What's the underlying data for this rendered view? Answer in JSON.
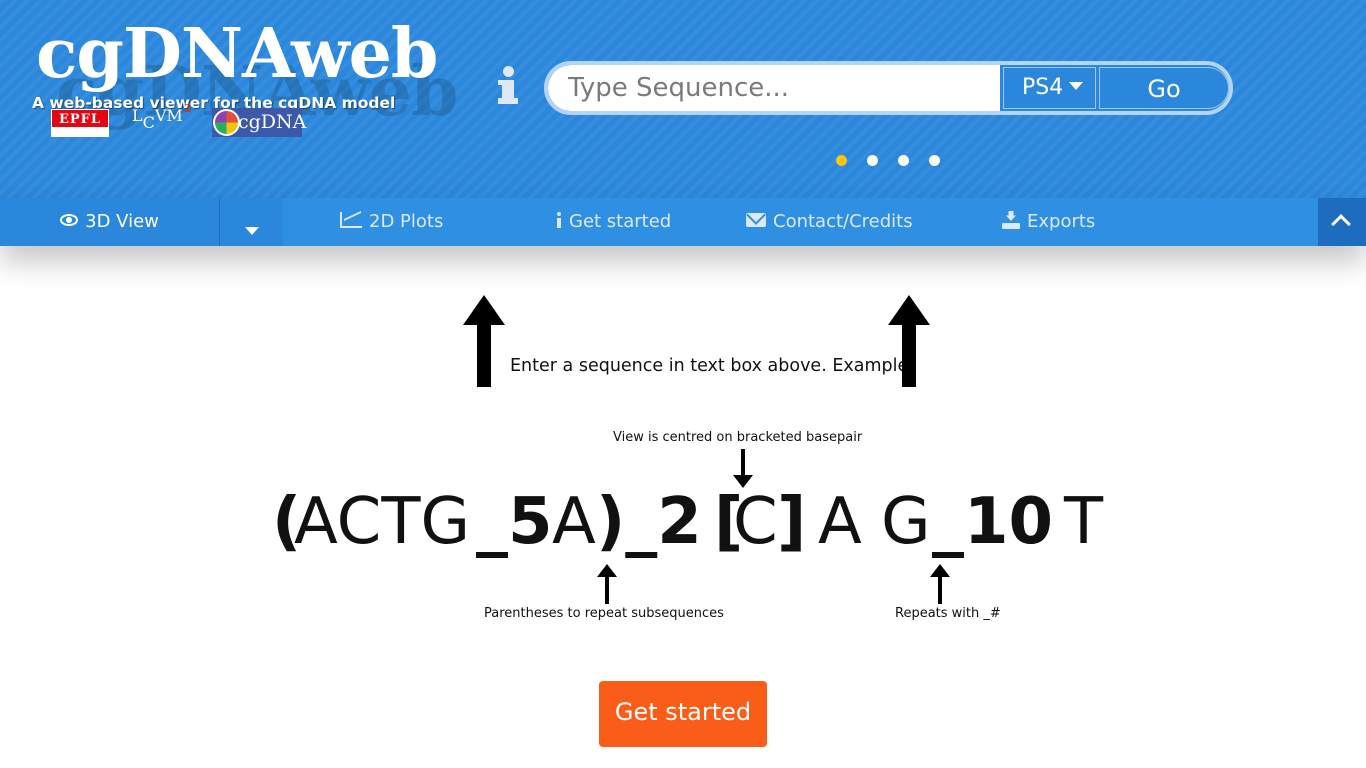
{
  "header": {
    "logo_text": "cgDNAweb",
    "tagline": "A web-based viewer for the cgDNA model",
    "partners": [
      {
        "name": "EPFL",
        "label": "EPFL"
      },
      {
        "name": "LCVM",
        "label_main": "L",
        "label_sub": "C",
        "label_rest": "VM",
        "label_sup": "2"
      },
      {
        "name": "cgDNA",
        "label": "cgDNA"
      }
    ]
  },
  "search": {
    "placeholder": "Type Sequence...",
    "value": "",
    "model_selected": "PS4",
    "go_label": "Go"
  },
  "carousel": {
    "dot_count": 4,
    "active_index": 0,
    "active_color": "#f5c518"
  },
  "nav": {
    "view_label": "3D View",
    "plots_label": "2D Plots",
    "get_started_label": "Get started",
    "contact_label": "Contact/Credits",
    "exports_label": "Exports"
  },
  "content": {
    "instruction": "Enter a sequence in text box above. Example:",
    "annot_centre": "View is centred on bracketed basepair",
    "annot_paren": "Parentheses to repeat subsequences",
    "annot_repeat": "Repeats with _#",
    "example_tokens": [
      {
        "text": "(",
        "bold": true
      },
      {
        "text": "ACTG",
        "bold": false
      },
      {
        "text": "_5",
        "bold": true
      },
      {
        "text": "A",
        "bold": false
      },
      {
        "text": ")_2",
        "bold": true
      },
      {
        "text": "[",
        "bold": true
      },
      {
        "text": "C",
        "bold": false
      },
      {
        "text": "]",
        "bold": true
      },
      {
        "text": "A",
        "bold": false
      },
      {
        "text": "G",
        "bold": false
      },
      {
        "text": "_10",
        "bold": true
      },
      {
        "text": "T",
        "bold": false
      }
    ],
    "get_started_button": "Get started"
  },
  "colors": {
    "header_blue": "#2b87db",
    "accent_orange": "#f95d17"
  }
}
